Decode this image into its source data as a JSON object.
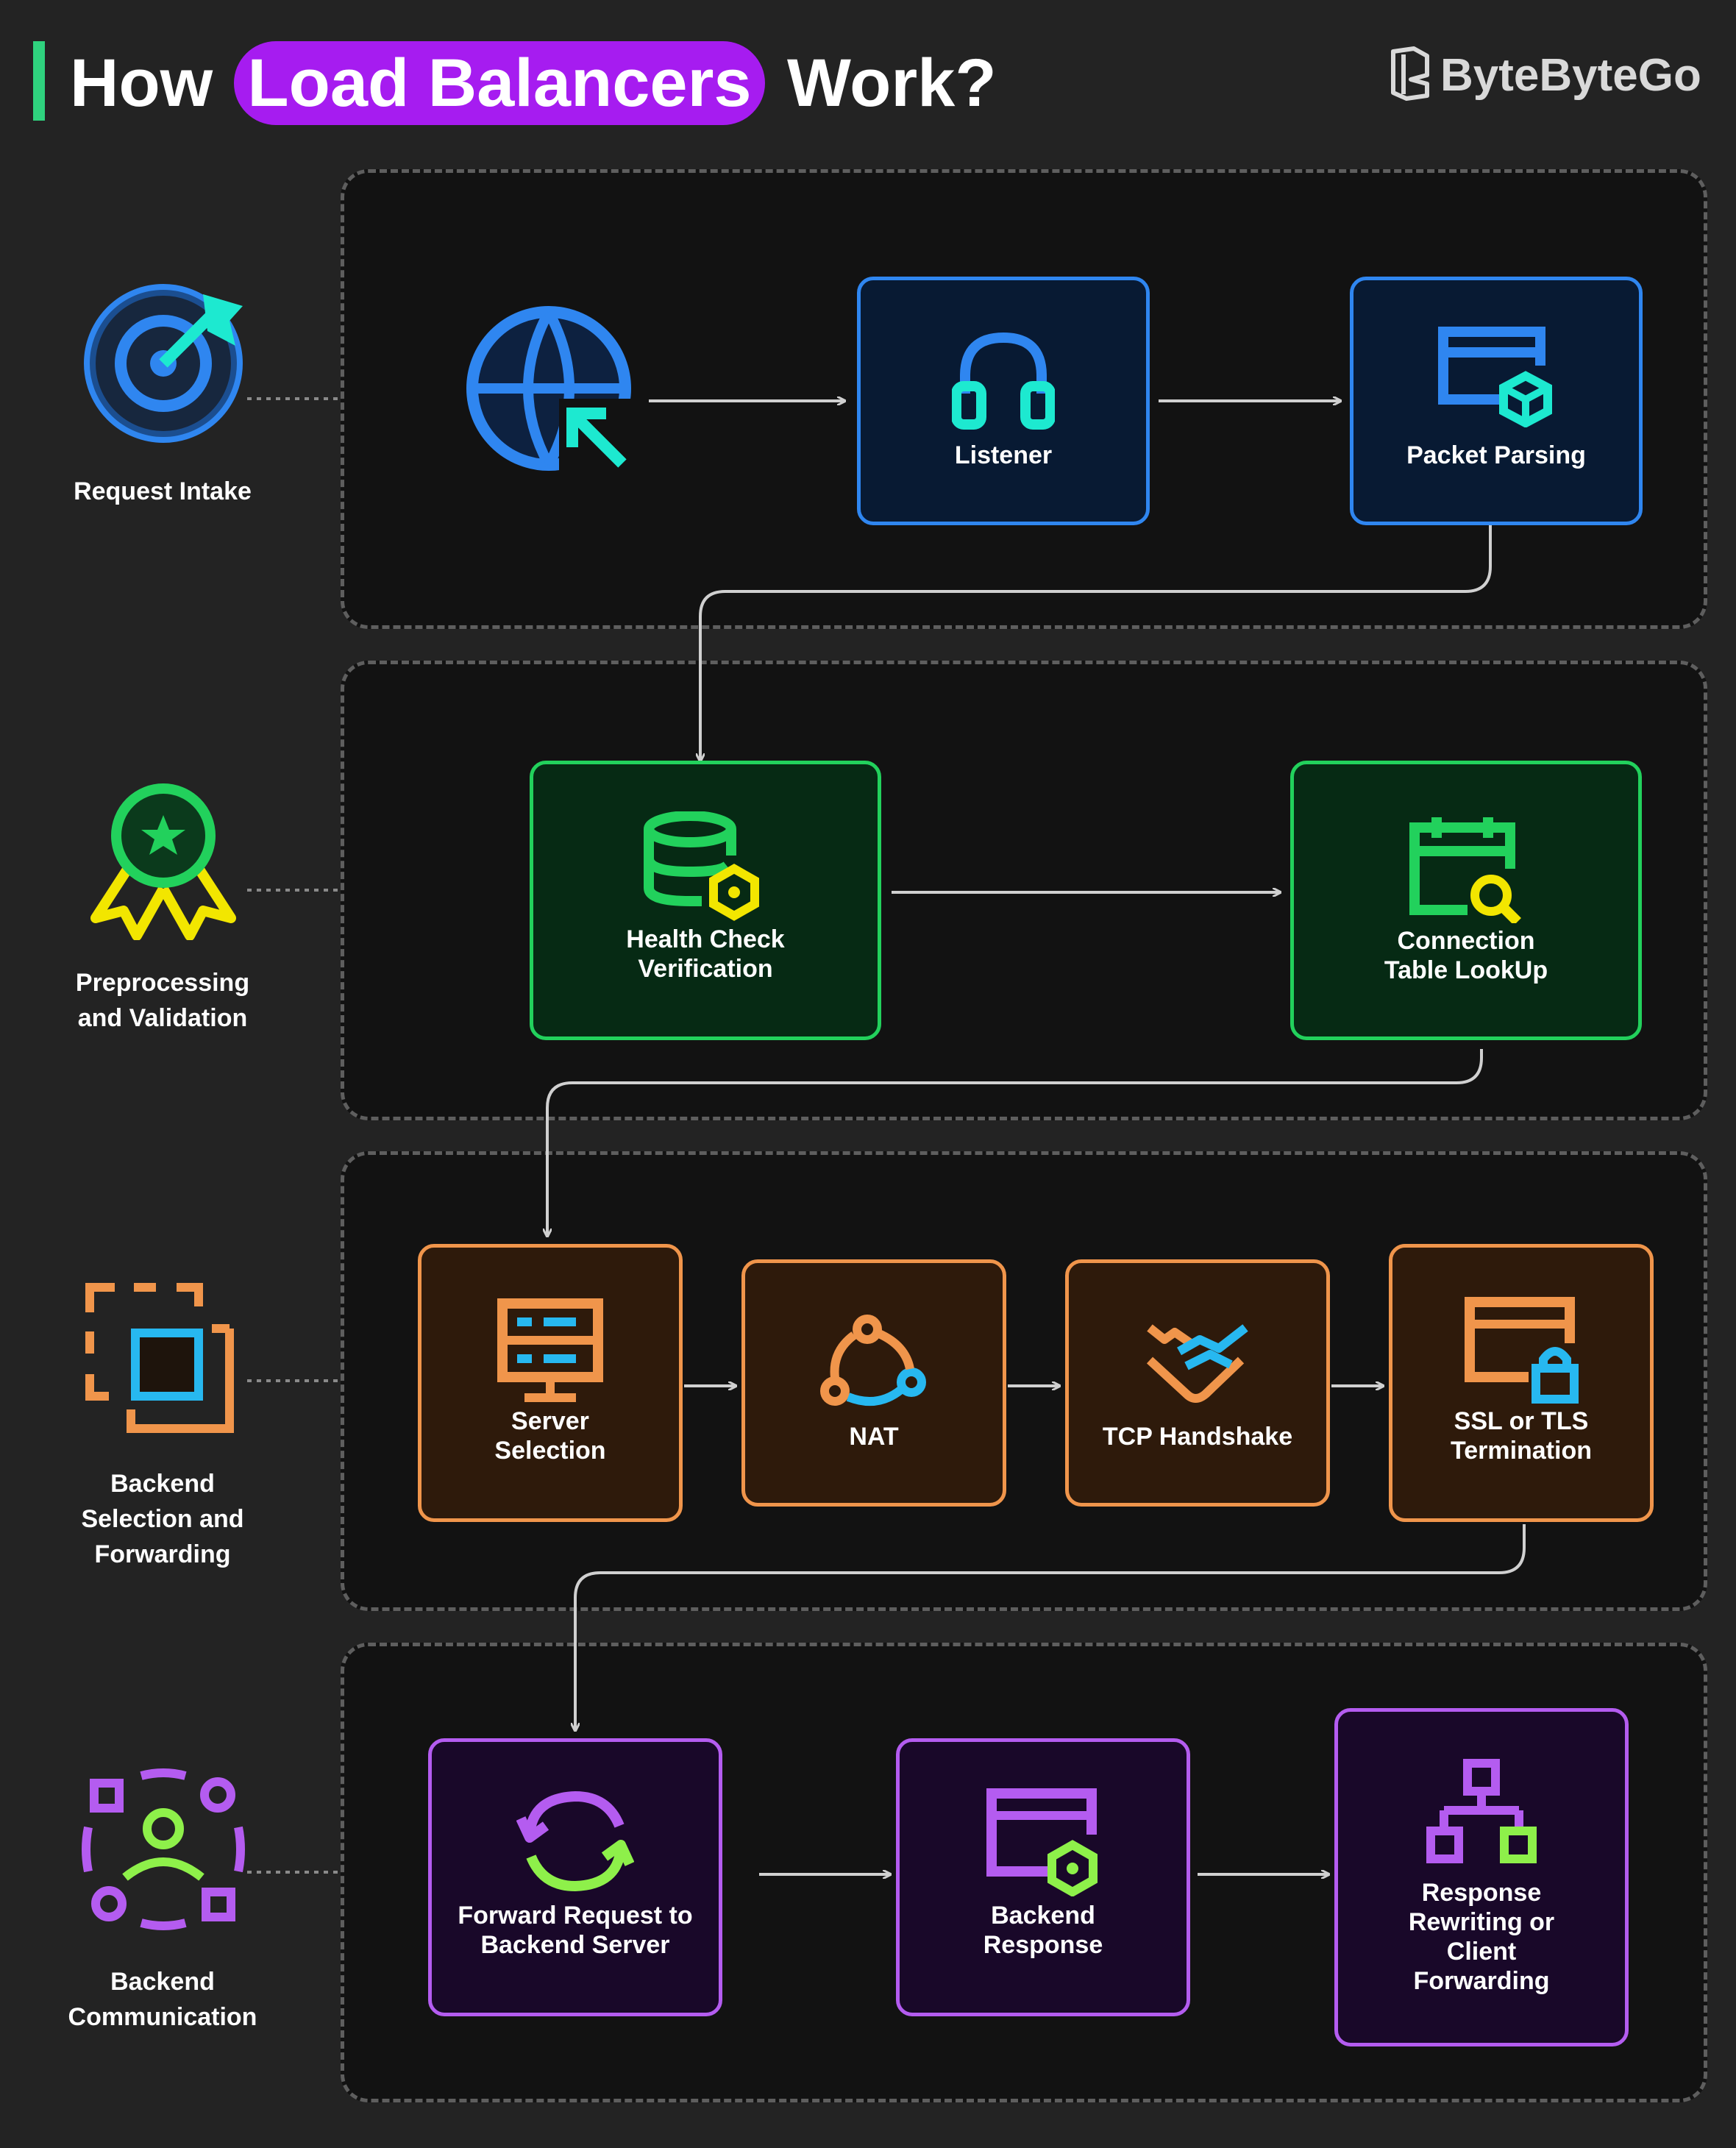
{
  "header": {
    "title_prefix": "How",
    "title_highlight": "Load Balancers",
    "title_suffix": "Work?",
    "brand": "ByteByteGo"
  },
  "stages": [
    {
      "label": "Request Intake",
      "steps": [
        "Listener",
        "Packet Parsing"
      ]
    },
    {
      "label": "Preprocessing and Validation",
      "steps": [
        "Health Check\nVerification",
        "Connection\nTable LookUp"
      ]
    },
    {
      "label": "Backend Selection and Forwarding",
      "steps": [
        "Server\nSelection",
        "NAT",
        "TCP Handshake",
        "SSL or TLS\nTermination"
      ]
    },
    {
      "label": "Backend Communication",
      "steps": [
        "Forward Request to\nBackend Server",
        "Backend\nResponse",
        "Response\nRewriting or\nClient\nForwarding"
      ]
    }
  ],
  "colors": {
    "request_intake": "#2f86f0",
    "preprocessing": "#22d15c",
    "backend_selection": "#f0954b",
    "backend_communication": "#b45cf0",
    "accent_cyan": "#1de9d0",
    "accent_yellow": "#f2e600",
    "title_highlight": "#a61cf0",
    "title_bar": "#2fd27e"
  },
  "icons": {
    "stage1": "target-icon",
    "stage2": "award-ribbon-icon",
    "stage3": "selection-frame-icon",
    "stage4": "network-people-icon",
    "entry": "globe-cursor-icon",
    "listener": "headphones-icon",
    "packet_parsing": "window-package-icon",
    "health_check": "database-settings-icon",
    "connection_table": "calendar-search-icon",
    "server_selection": "server-monitor-icon",
    "nat": "route-nodes-icon",
    "tcp_handshake": "handshake-icon",
    "ssl_tls": "window-lock-icon",
    "forward_request": "sync-arrows-icon",
    "backend_response": "window-settings-icon",
    "response_rewriting": "hierarchy-icon"
  }
}
